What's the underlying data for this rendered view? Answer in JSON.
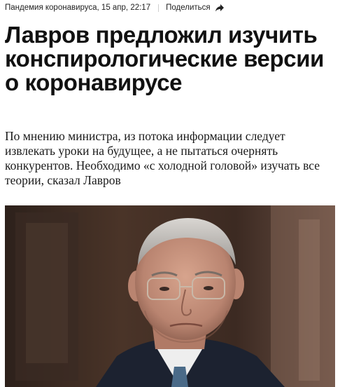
{
  "meta": {
    "rubric": "Пандемия коронавируса",
    "datetime": ", 15 апр, 22:17",
    "share_label": "Поделиться",
    "share_icon": "share-arrow-icon"
  },
  "article": {
    "headline": "Лавров предложил изучить конспирологические версии о коронавирусе",
    "lead": "По мнению министра, из потока информации следует извлекать уроки на будущее, а не пытаться очернять конкурентов. Необходимо «с холодной головой» изучать все теории, сказал Лавров"
  },
  "photo": {
    "subject": "portrait-of-official"
  }
}
